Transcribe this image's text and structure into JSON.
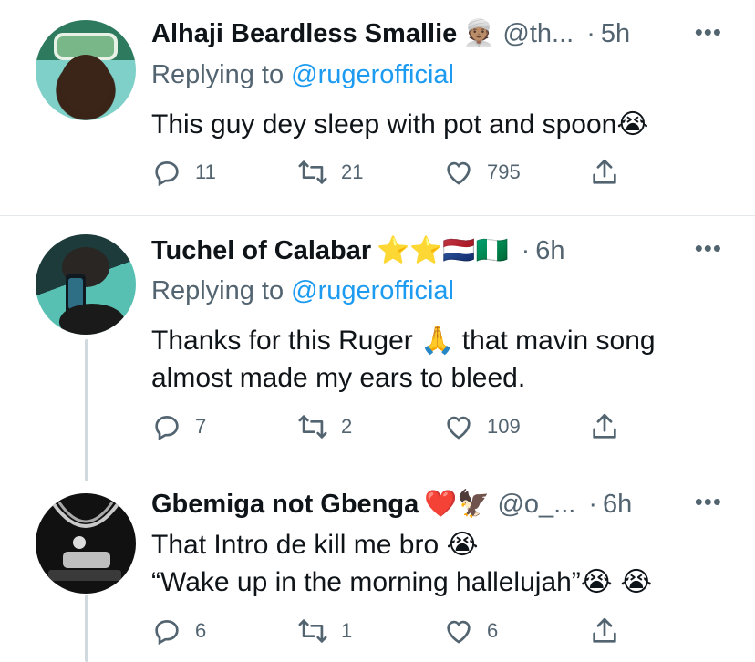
{
  "tweets": [
    {
      "name": "Alhaji Beardless Smallie",
      "name_emoji": "👳🏽",
      "handle": "@th...",
      "time": "5h",
      "reply_label": "Replying to",
      "reply_to": "@rugerofficial",
      "text_lines": [
        "This guy dey sleep with pot and spoon😭"
      ],
      "replies": "11",
      "retweets": "21",
      "likes": "795"
    },
    {
      "name": "Tuchel of Calabar",
      "name_emoji": "⭐⭐🇳🇱🇳🇬",
      "handle": "",
      "time": "6h",
      "reply_label": "Replying to",
      "reply_to": "@rugerofficial",
      "text_lines": [
        "Thanks for this Ruger 🙏 that mavin song",
        "almost made my ears to bleed."
      ],
      "replies": "7",
      "retweets": "2",
      "likes": "109"
    },
    {
      "name": "Gbemiga not Gbenga",
      "name_emoji": "❤️🦅",
      "handle": "@o_...",
      "time": "6h",
      "text_lines": [
        "That Intro de kill me bro 😭",
        "“Wake up in the morning hallelujah”😭 😭"
      ],
      "replies": "6",
      "retweets": "1",
      "likes": "6"
    }
  ],
  "icons": {
    "more": "more-horizontal-icon",
    "reply": "reply-icon",
    "retweet": "retweet-icon",
    "like": "heart-icon",
    "share": "share-icon"
  },
  "symbols": {
    "dot": "·",
    "more": "•••"
  },
  "colors": {
    "text": "#0f1419",
    "secondary": "#536471",
    "link": "#1d9bf0",
    "divider": "#e6e9ec"
  }
}
